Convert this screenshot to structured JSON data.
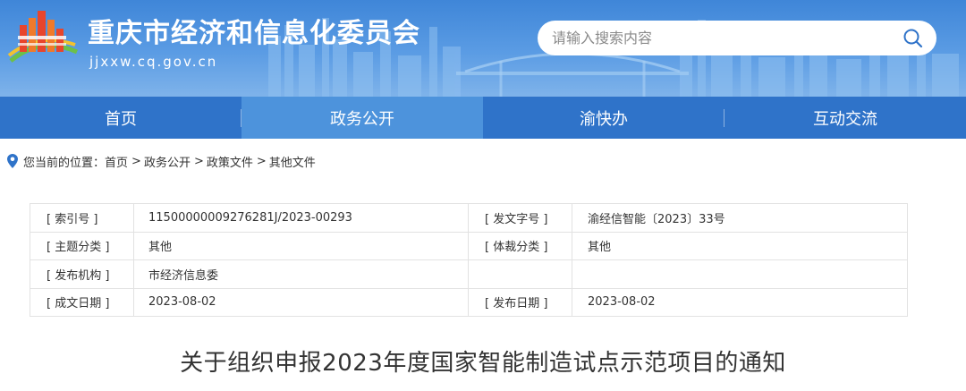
{
  "header": {
    "site_title": "重庆市经济和信息化委员会",
    "site_domain": "jjxxw.cq.gov.cn",
    "search_placeholder": "请输入搜索内容"
  },
  "nav": [
    {
      "label": "首页",
      "active": false
    },
    {
      "label": "政务公开",
      "active": true
    },
    {
      "label": "渝快办",
      "active": false
    },
    {
      "label": "互动交流",
      "active": false
    }
  ],
  "breadcrumb": {
    "prefix": "您当前的位置：",
    "items": [
      "首页",
      "政务公开",
      "政策文件",
      "其他文件"
    ],
    "sep": ">"
  },
  "info_table": {
    "rows": [
      {
        "k1": "[ 索引号 ]",
        "v1": "11500000009276281J/2023-00293",
        "k2": "[ 发文字号 ]",
        "v2": "渝经信智能〔2023〕33号"
      },
      {
        "k1": "[ 主题分类 ]",
        "v1": "其他",
        "k2": "[ 体裁分类 ]",
        "v2": "其他"
      },
      {
        "k1": "[ 发布机构 ]",
        "v1": "市经济信息委",
        "k2": "",
        "v2": ""
      },
      {
        "k1": "[ 成文日期 ]",
        "v1": "2023-08-02",
        "k2": "[ 发布日期 ]",
        "v2": "2023-08-02"
      }
    ]
  },
  "article": {
    "title": "关于组织申报2023年度国家智能制造试点示范项目的通知"
  },
  "colors": {
    "banner_blue": "#3f86d8",
    "nav_blue": "#2f73c9",
    "nav_active": "#4d93dc"
  },
  "icons": {
    "logo": "chongqing-emblem-icon",
    "search": "search-icon",
    "location": "location-pin-icon"
  }
}
